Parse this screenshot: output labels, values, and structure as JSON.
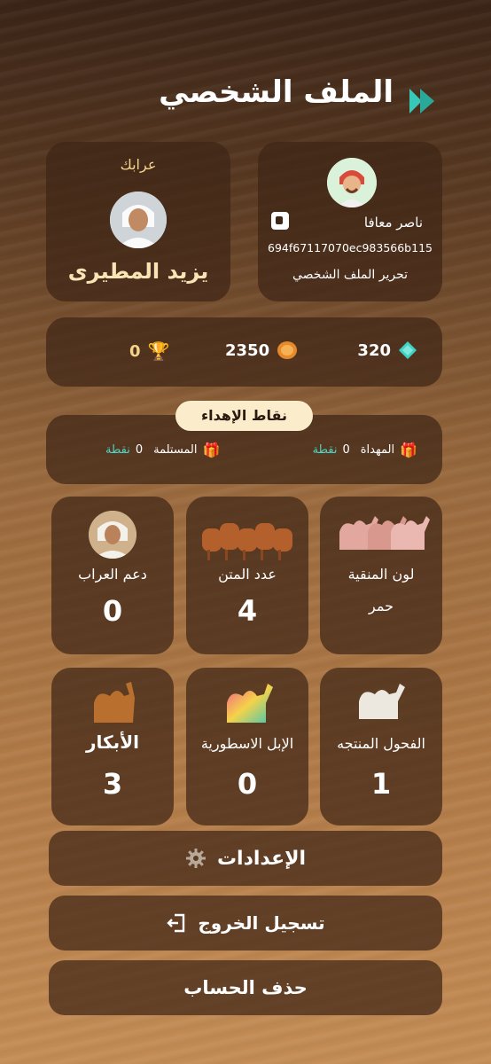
{
  "header": {
    "title": "الملف الشخصي"
  },
  "user": {
    "name": "ناصر معافا",
    "id": "694f67117070ec983566b115",
    "edit_label": "تحرير الملف الشخصي"
  },
  "owner": {
    "label": "عرابك",
    "name": "يزيد المطيرى"
  },
  "stats": {
    "gems": "320",
    "coins": "2350",
    "trophies": "0"
  },
  "gift": {
    "title": "نقاط الإهداء",
    "given_label": "المهداة",
    "given_value": "0",
    "given_unit": "نقطة",
    "received_label": "المستلمة",
    "received_value": "0",
    "received_unit": "نقطة"
  },
  "tiles": [
    {
      "label": "لون المنقية",
      "value": "حمر"
    },
    {
      "label": "عدد المتن",
      "value": "4"
    },
    {
      "label": "دعم العراب",
      "value": "0"
    },
    {
      "label": "الفحول المنتجه",
      "value": "1"
    },
    {
      "label": "الإبل الاسطورية",
      "value": "0"
    },
    {
      "label": "الأبكار",
      "value": "3"
    }
  ],
  "buttons": {
    "settings": "الإعدادات",
    "logout": "تسجيل الخروج",
    "delete": "حذف الحساب"
  },
  "colors": {
    "teal": "#4fd6c6",
    "card": "#3e2616",
    "gold_pill": "#fbeccb"
  }
}
